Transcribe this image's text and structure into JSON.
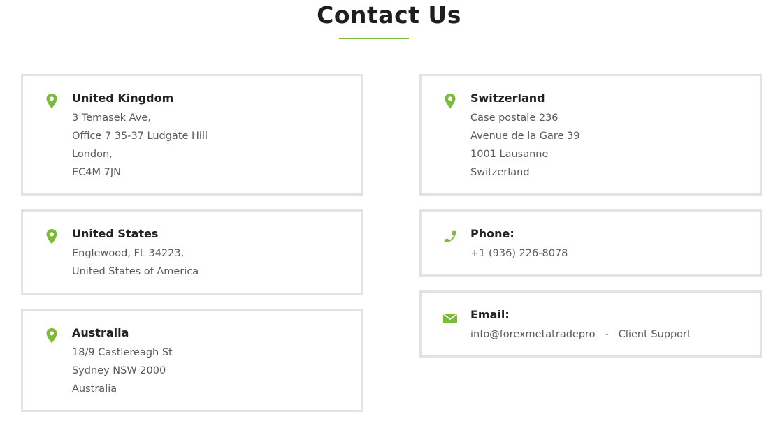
{
  "page": {
    "title": "Contact Us"
  },
  "colors": {
    "accent": "#7cbb3a",
    "card_border": "#e3e3e3",
    "heading": "#222222",
    "text": "#5a5a5a"
  },
  "cards": {
    "uk": {
      "icon": "location-pin-icon",
      "heading": "United Kingdom",
      "lines": [
        "3 Temasek Ave,",
        "Office 7 35-37 Ludgate Hill",
        "London,",
        "EC4M 7JN"
      ]
    },
    "switzerland": {
      "icon": "location-pin-icon",
      "heading": "Switzerland",
      "lines": [
        "Case postale 236",
        "Avenue de la Gare 39",
        "1001 Lausanne",
        "Switzerland"
      ]
    },
    "us": {
      "icon": "location-pin-icon",
      "heading": "United States",
      "lines": [
        "Englewood, FL 34223,",
        "United States of America"
      ]
    },
    "phone": {
      "icon": "phone-icon",
      "heading": "Phone:",
      "number": "+1 (936) 226-8078"
    },
    "australia": {
      "icon": "location-pin-icon",
      "heading": "Australia",
      "lines": [
        "18/9 Castlereagh St",
        "Sydney NSW 2000",
        "Australia"
      ]
    },
    "email": {
      "icon": "envelope-icon",
      "heading": "Email:",
      "address": "info@forexmetatradepro",
      "separator": "-",
      "support_label": "Client Support"
    }
  }
}
